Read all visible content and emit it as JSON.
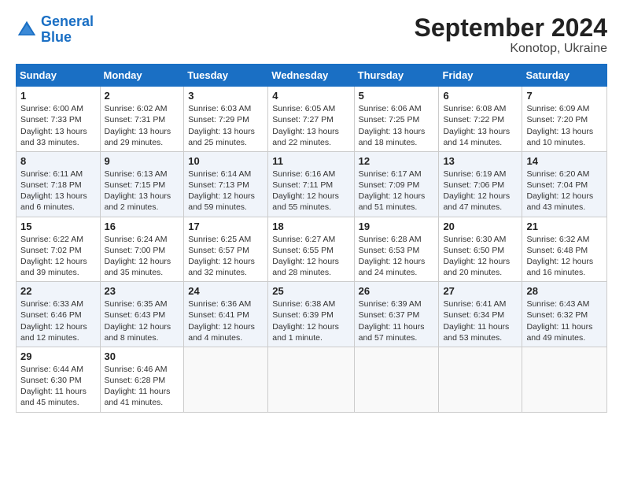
{
  "header": {
    "logo_line1": "General",
    "logo_line2": "Blue",
    "title": "September 2024",
    "subtitle": "Konotop, Ukraine"
  },
  "days_of_week": [
    "Sunday",
    "Monday",
    "Tuesday",
    "Wednesday",
    "Thursday",
    "Friday",
    "Saturday"
  ],
  "weeks": [
    [
      {
        "num": "1",
        "info": "Sunrise: 6:00 AM\nSunset: 7:33 PM\nDaylight: 13 hours\nand 33 minutes."
      },
      {
        "num": "2",
        "info": "Sunrise: 6:02 AM\nSunset: 7:31 PM\nDaylight: 13 hours\nand 29 minutes."
      },
      {
        "num": "3",
        "info": "Sunrise: 6:03 AM\nSunset: 7:29 PM\nDaylight: 13 hours\nand 25 minutes."
      },
      {
        "num": "4",
        "info": "Sunrise: 6:05 AM\nSunset: 7:27 PM\nDaylight: 13 hours\nand 22 minutes."
      },
      {
        "num": "5",
        "info": "Sunrise: 6:06 AM\nSunset: 7:25 PM\nDaylight: 13 hours\nand 18 minutes."
      },
      {
        "num": "6",
        "info": "Sunrise: 6:08 AM\nSunset: 7:22 PM\nDaylight: 13 hours\nand 14 minutes."
      },
      {
        "num": "7",
        "info": "Sunrise: 6:09 AM\nSunset: 7:20 PM\nDaylight: 13 hours\nand 10 minutes."
      }
    ],
    [
      {
        "num": "8",
        "info": "Sunrise: 6:11 AM\nSunset: 7:18 PM\nDaylight: 13 hours\nand 6 minutes."
      },
      {
        "num": "9",
        "info": "Sunrise: 6:13 AM\nSunset: 7:15 PM\nDaylight: 13 hours\nand 2 minutes."
      },
      {
        "num": "10",
        "info": "Sunrise: 6:14 AM\nSunset: 7:13 PM\nDaylight: 12 hours\nand 59 minutes."
      },
      {
        "num": "11",
        "info": "Sunrise: 6:16 AM\nSunset: 7:11 PM\nDaylight: 12 hours\nand 55 minutes."
      },
      {
        "num": "12",
        "info": "Sunrise: 6:17 AM\nSunset: 7:09 PM\nDaylight: 12 hours\nand 51 minutes."
      },
      {
        "num": "13",
        "info": "Sunrise: 6:19 AM\nSunset: 7:06 PM\nDaylight: 12 hours\nand 47 minutes."
      },
      {
        "num": "14",
        "info": "Sunrise: 6:20 AM\nSunset: 7:04 PM\nDaylight: 12 hours\nand 43 minutes."
      }
    ],
    [
      {
        "num": "15",
        "info": "Sunrise: 6:22 AM\nSunset: 7:02 PM\nDaylight: 12 hours\nand 39 minutes."
      },
      {
        "num": "16",
        "info": "Sunrise: 6:24 AM\nSunset: 7:00 PM\nDaylight: 12 hours\nand 35 minutes."
      },
      {
        "num": "17",
        "info": "Sunrise: 6:25 AM\nSunset: 6:57 PM\nDaylight: 12 hours\nand 32 minutes."
      },
      {
        "num": "18",
        "info": "Sunrise: 6:27 AM\nSunset: 6:55 PM\nDaylight: 12 hours\nand 28 minutes."
      },
      {
        "num": "19",
        "info": "Sunrise: 6:28 AM\nSunset: 6:53 PM\nDaylight: 12 hours\nand 24 minutes."
      },
      {
        "num": "20",
        "info": "Sunrise: 6:30 AM\nSunset: 6:50 PM\nDaylight: 12 hours\nand 20 minutes."
      },
      {
        "num": "21",
        "info": "Sunrise: 6:32 AM\nSunset: 6:48 PM\nDaylight: 12 hours\nand 16 minutes."
      }
    ],
    [
      {
        "num": "22",
        "info": "Sunrise: 6:33 AM\nSunset: 6:46 PM\nDaylight: 12 hours\nand 12 minutes."
      },
      {
        "num": "23",
        "info": "Sunrise: 6:35 AM\nSunset: 6:43 PM\nDaylight: 12 hours\nand 8 minutes."
      },
      {
        "num": "24",
        "info": "Sunrise: 6:36 AM\nSunset: 6:41 PM\nDaylight: 12 hours\nand 4 minutes."
      },
      {
        "num": "25",
        "info": "Sunrise: 6:38 AM\nSunset: 6:39 PM\nDaylight: 12 hours\nand 1 minute."
      },
      {
        "num": "26",
        "info": "Sunrise: 6:39 AM\nSunset: 6:37 PM\nDaylight: 11 hours\nand 57 minutes."
      },
      {
        "num": "27",
        "info": "Sunrise: 6:41 AM\nSunset: 6:34 PM\nDaylight: 11 hours\nand 53 minutes."
      },
      {
        "num": "28",
        "info": "Sunrise: 6:43 AM\nSunset: 6:32 PM\nDaylight: 11 hours\nand 49 minutes."
      }
    ],
    [
      {
        "num": "29",
        "info": "Sunrise: 6:44 AM\nSunset: 6:30 PM\nDaylight: 11 hours\nand 45 minutes."
      },
      {
        "num": "30",
        "info": "Sunrise: 6:46 AM\nSunset: 6:28 PM\nDaylight: 11 hours\nand 41 minutes."
      },
      {
        "num": "",
        "info": ""
      },
      {
        "num": "",
        "info": ""
      },
      {
        "num": "",
        "info": ""
      },
      {
        "num": "",
        "info": ""
      },
      {
        "num": "",
        "info": ""
      }
    ]
  ]
}
